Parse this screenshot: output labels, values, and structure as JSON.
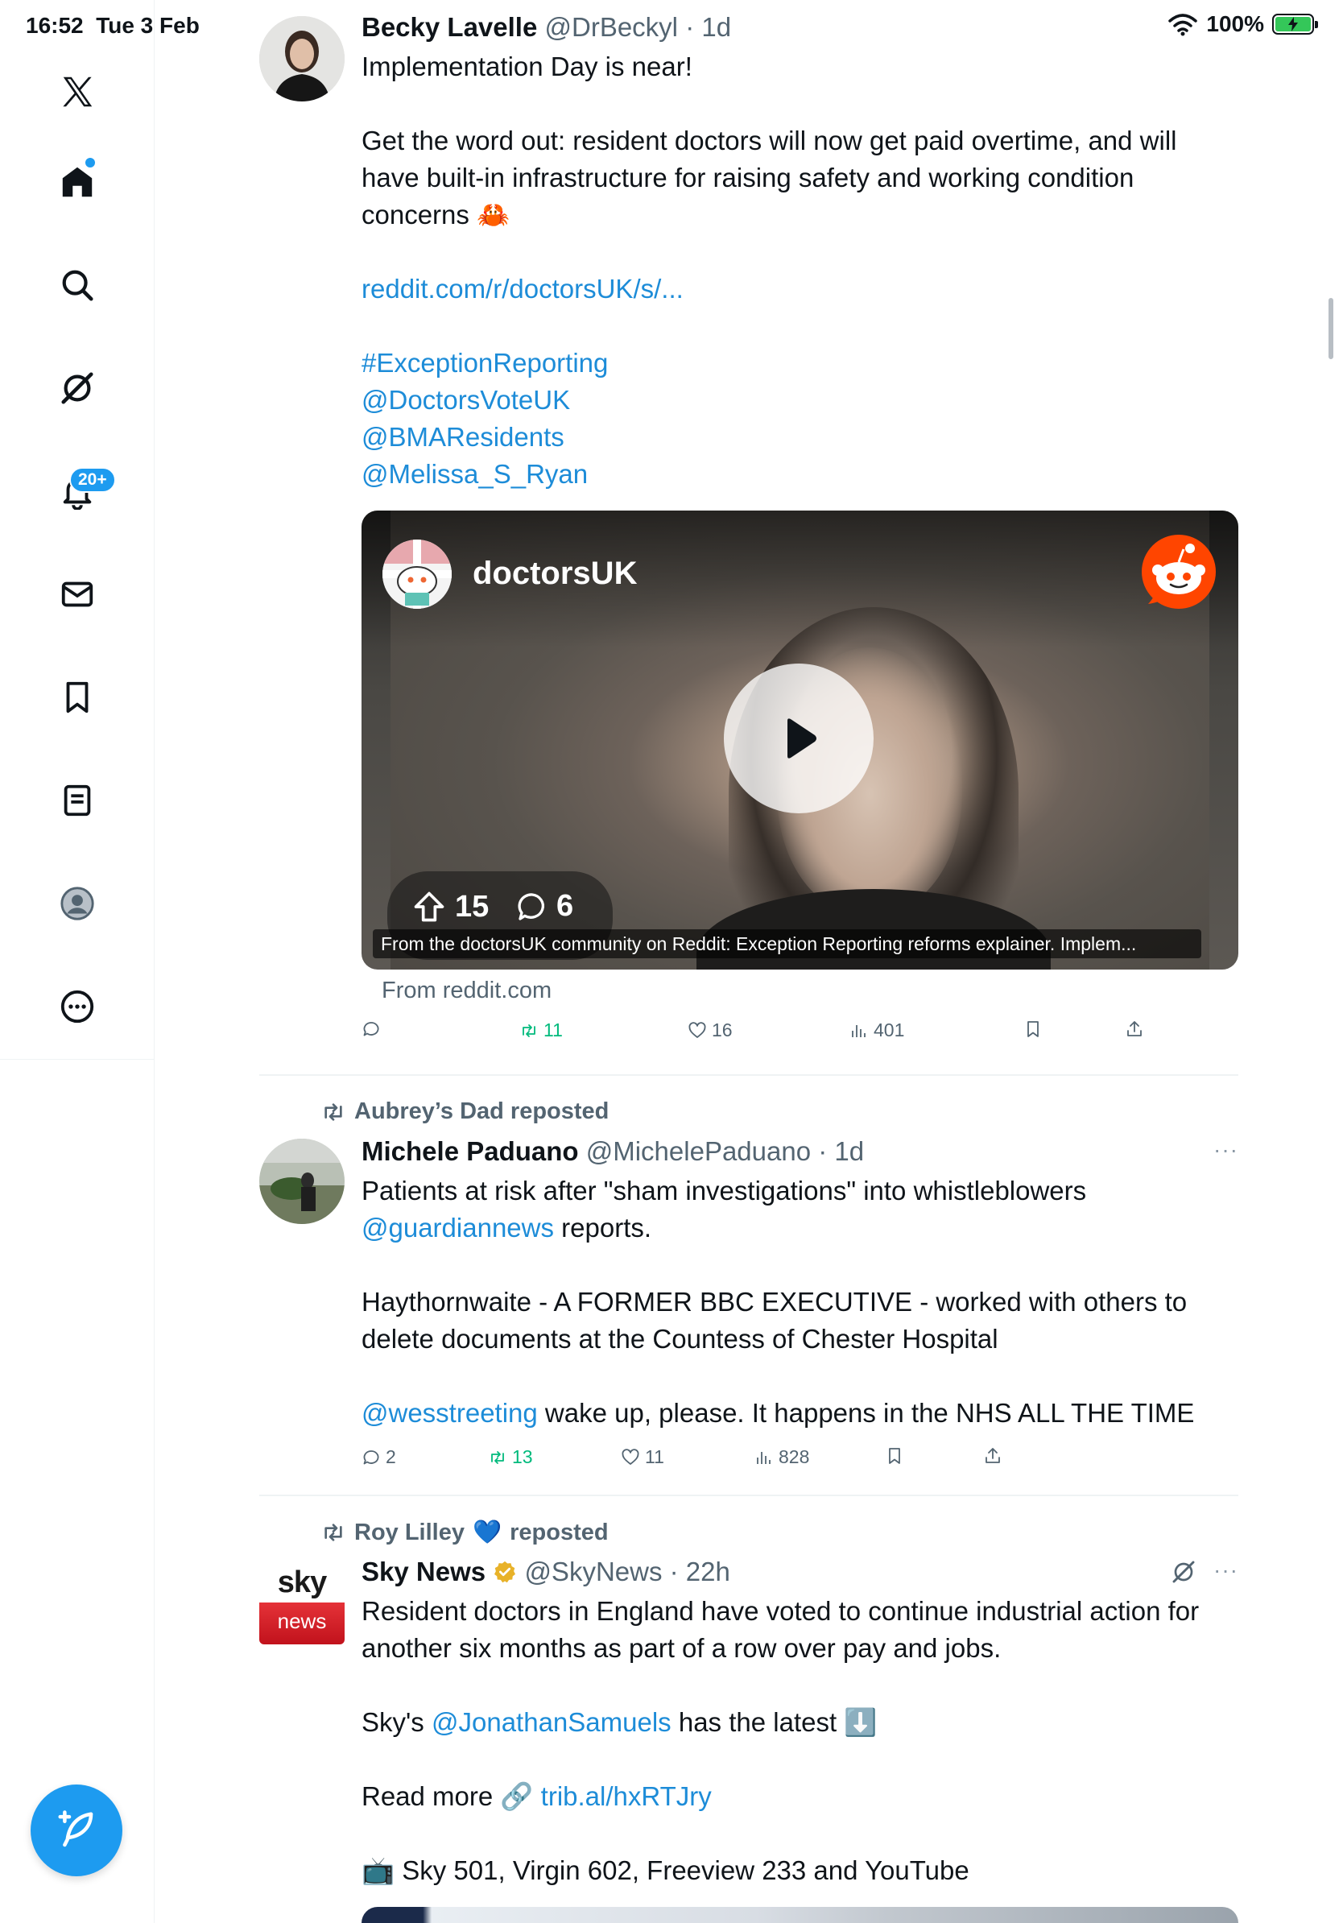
{
  "status": {
    "time": "16:52",
    "date": "Tue 3 Feb",
    "battery": "100%",
    "battery_level": 1.0
  },
  "nav": {
    "notifications_badge": "20+",
    "items": [
      "x-logo",
      "home",
      "search",
      "grok",
      "notifications",
      "messages",
      "bookmarks",
      "lists",
      "profile",
      "more"
    ]
  },
  "colors": {
    "accent": "#1d9bf0",
    "link": "#1d8cd8",
    "repost_green": "#00ba7c",
    "muted": "#536471",
    "reddit": "#ff4500"
  },
  "tweets": [
    {
      "name": "Becky Lavelle",
      "handle": "@DrBeckyl",
      "time": "· 1d",
      "line1": "Implementation Day is near!",
      "line2": "Get the word out: resident doctors will now get paid overtime, and will",
      "line3": "have built-in infrastructure for raising safety and working condition",
      "line4": "concerns 🦀",
      "link": "reddit.com/r/doctorsUK/s/...",
      "hashtag": "#ExceptionReporting",
      "mention1": "@DoctorsVoteUK",
      "mention2": "@BMAResidents",
      "mention3": "@Melissa_S_Ryan",
      "card": {
        "subreddit": "doctorsUK",
        "upvotes": "15",
        "comments": "6",
        "caption": "From the doctorsUK community on Reddit: Exception Reporting reforms explainer. Implem...",
        "from": "From reddit.com"
      },
      "actions": {
        "replies": "",
        "reposts": "11",
        "likes": "16",
        "views": "401"
      }
    },
    {
      "reposted_by": "Aubrey’s Dad reposted",
      "name": "Michele Paduano",
      "handle": "@MichelePaduano",
      "time": "· 1d",
      "line1": "Patients at risk after \"sham investigations\" into whistleblowers",
      "mention1": "@guardiannews",
      "line1b": " reports.",
      "line2": "Haythornwaite - A FORMER BBC EXECUTIVE - worked with others to",
      "line3": "delete documents at the Countess of Chester Hospital",
      "mention2": "@wesstreeting",
      "line4": " wake up, please. It happens in the NHS ALL THE TIME",
      "more": "···",
      "actions": {
        "replies": "2",
        "reposts": "13",
        "likes": "11",
        "views": "828"
      }
    },
    {
      "reposted_by_name": "Roy Lilley",
      "reposted_by_emoji": "💙",
      "reposted_suffix": "reposted",
      "name": "Sky News",
      "handle": "@SkyNews",
      "time": "· 22h",
      "logo_top": "sky",
      "logo_bottom": "news",
      "line1": "Resident doctors in England have voted to continue industrial action for",
      "line2": "another six months as part of a row over pay and jobs.",
      "line3a": "Sky's ",
      "mention": "@JonathanSamuels",
      "line3b": " has the latest ⬇️",
      "line4a": "Read more 🔗 ",
      "link": "trib.al/hxRTJry",
      "line5": "📺 Sky 501, Virgin 602, Freeview 233 and YouTube",
      "more": "···"
    }
  ]
}
